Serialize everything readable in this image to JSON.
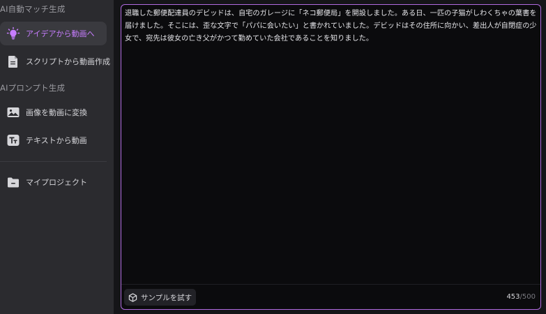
{
  "sidebar": {
    "section_auto": "AI自動マッチ生成",
    "section_prompt": "AIプロンプト生成",
    "items": [
      {
        "label": "アイデアから動画へ",
        "icon": "lightbulb-icon",
        "active": true
      },
      {
        "label": "スクリプトから動画作成",
        "icon": "document-icon",
        "active": false
      },
      {
        "label": "画像を動画に変換",
        "icon": "image-icon",
        "active": false
      },
      {
        "label": "テキストから動画",
        "icon": "text-icon",
        "active": false
      },
      {
        "label": "マイプロジェクト",
        "icon": "folder-icon",
        "active": false
      }
    ]
  },
  "editor": {
    "text": "退職した郵便配達員のデビッドは、自宅のガレージに「ネコ郵便局」を開設しました。ある日、一匹の子猫がしわくちゃの葉書を届けました。そこには、歪な文字で「パパに会いたい」と書かれていました。デビッドはその住所に向かい、差出人が自閉症の少女で、宛先は彼女の亡き父がかつて勤めていた会社であることを知りました。",
    "sample_label": "サンプルを試す",
    "count": "453",
    "max": "/500"
  },
  "colors": {
    "accent": "#c77dff",
    "border": "#b16be0",
    "sidebar_bg": "#2b2b2f",
    "editor_bg": "#0b0b0d"
  }
}
